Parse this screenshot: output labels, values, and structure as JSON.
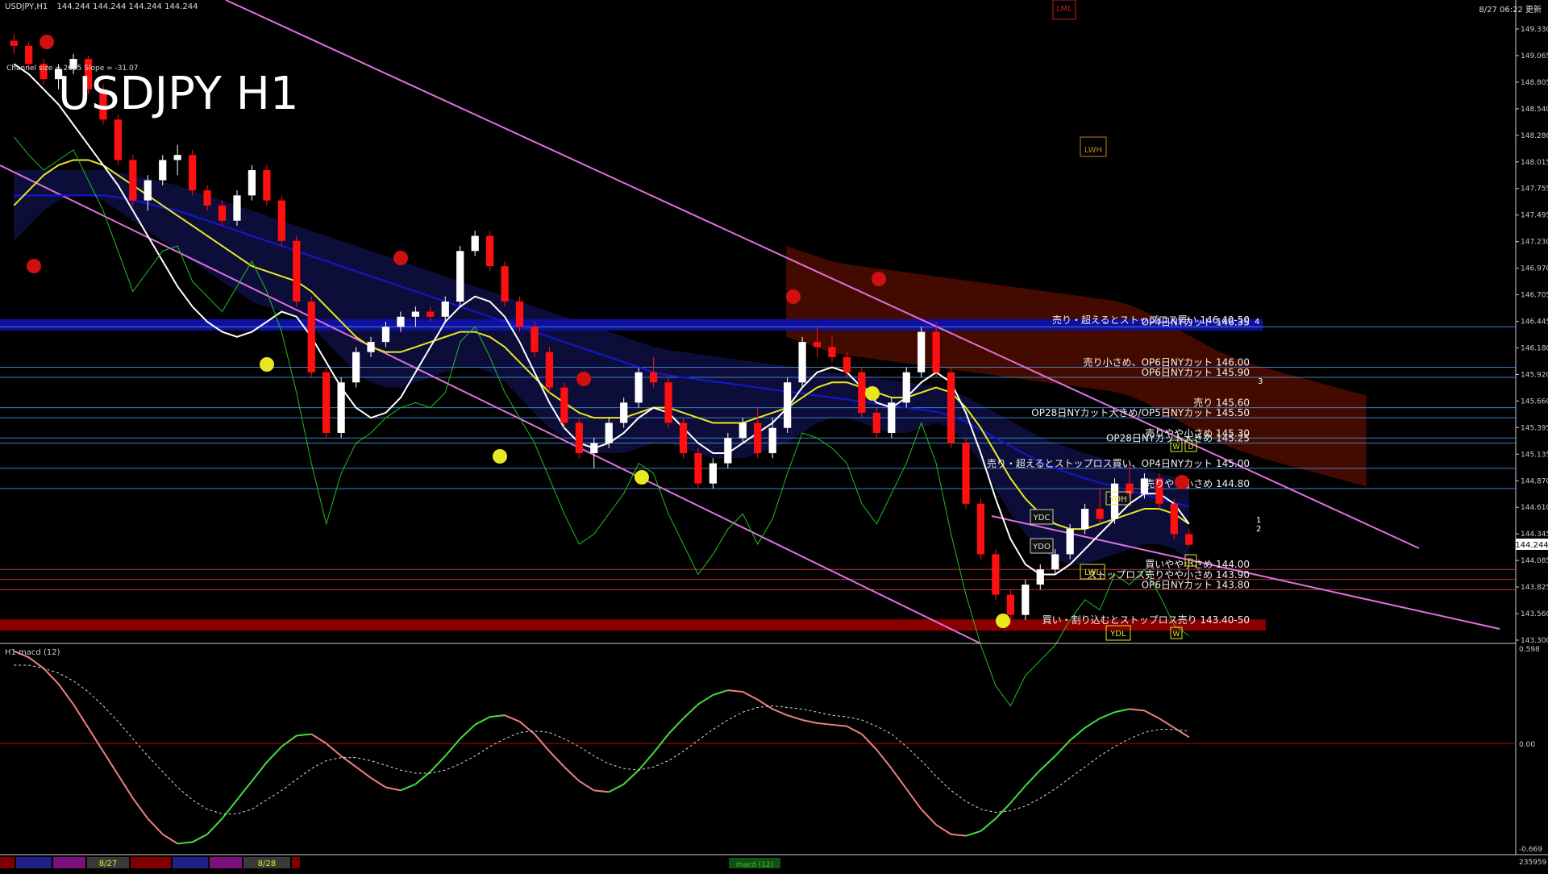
{
  "window": {
    "symbol_header": "USDJPY,H1",
    "ohlc_header": "144.244 144.244 144.244 144.244",
    "datetime": "8/27 06:22 更新",
    "big_title": "USDJPY H1",
    "channel_info": "Channel size = 2695 Slope = -31.07",
    "lml_box": "LML",
    "lwh_box": "LWH",
    "current_price": "144.244"
  },
  "price_axis": {
    "min": 143.3,
    "max": 149.33,
    "ticks": [
      "149.330",
      "149.065",
      "148.805",
      "148.540",
      "148.280",
      "148.015",
      "147.755",
      "147.495",
      "147.230",
      "146.970",
      "146.705",
      "146.445",
      "146.180",
      "145.920",
      "145.660",
      "145.395",
      "145.135",
      "144.870",
      "144.610",
      "144.345",
      "144.085",
      "143.825",
      "143.560",
      "143.300"
    ]
  },
  "levels": [
    {
      "price": 146.42,
      "label": "売り・超えるとストップロス買い 146.40-50",
      "color": "#1010a0",
      "band": true
    },
    {
      "price": 146.4,
      "label": "OP4日NYカット 146.35",
      "color": "#3f7fbf"
    },
    {
      "price": 146.0,
      "label": "売り小さめ、OP6日NYカット 146.00",
      "color": "#3f7fbf"
    },
    {
      "price": 145.9,
      "label": "OP6日NYカット 145.90",
      "color": "#3f7fbf"
    },
    {
      "price": 145.6,
      "label": "売り 145.60",
      "color": "#3f7fbf"
    },
    {
      "price": 145.5,
      "label": "OP28日NYカット大きめ/OP5日NYカット 145.50",
      "color": "#3f7fbf"
    },
    {
      "price": 145.3,
      "label": "売りやや小さめ 145.30",
      "color": "#3f7fbf"
    },
    {
      "price": 145.25,
      "label": "OP28日NYカット大きめ 145.25",
      "color": "#3f7fbf"
    },
    {
      "price": 145.0,
      "label": "売り・超えるとストップロス買い、OP4日NYカット 145.00",
      "color": "#3f7fbf"
    },
    {
      "price": 144.8,
      "label": "売りやや小さめ 144.80",
      "color": "#3f7fbf"
    },
    {
      "price": 144.0,
      "label": "買いやや小さめ 144.00",
      "color": "#c03030"
    },
    {
      "price": 143.9,
      "label": "ストップロス売りやや小さめ 143.90",
      "color": "#c03030"
    },
    {
      "price": 143.8,
      "label": "OP6日NYカット 143.80",
      "color": "#c03030"
    },
    {
      "price": 143.45,
      "label": "買い・割り込むとストップロス売り 143.40-50",
      "color": "#8a0000",
      "band": true
    }
  ],
  "markers": {
    "ydc": "YDC",
    "ydo": "YDO",
    "ydh": "YDH",
    "lwl": "LWL",
    "ydl": "YDL",
    "w1": "W",
    "d1": "D",
    "w2": "W",
    "d2": "D",
    "n1": "1",
    "n2": "2",
    "n3": "3",
    "n4": "4"
  },
  "macd": {
    "label": "H1  macd (12)",
    "max": "0.598",
    "zero": "0.00",
    "min": "-0.669",
    "bottom_right": "235959"
  },
  "date_tabs": [
    "8/27",
    "8/28"
  ],
  "macd_tab": "macd (12)",
  "colors": {
    "bull": "#ffffff",
    "bear": "#ff1010",
    "ma_white": "#ffffff",
    "ma_yellow": "#e8e820",
    "ma_blue": "#1515d8",
    "ichimoku_lag": "#20c020",
    "kumo_blue": "#3030d0",
    "kumo_red": "#c02000",
    "channel": "#e070e0",
    "macd_up": "#40e040",
    "macd_down": "#f08080"
  },
  "chart_data": {
    "type": "candlestick",
    "title": "USDJPY H1",
    "ylim": [
      143.3,
      149.33
    ],
    "candles": [
      [
        149.23,
        149.3,
        149.1,
        149.18
      ],
      [
        149.18,
        149.22,
        148.95,
        149.0
      ],
      [
        149.0,
        149.05,
        148.8,
        148.85
      ],
      [
        148.85,
        149.0,
        148.75,
        148.95
      ],
      [
        148.95,
        149.1,
        148.9,
        149.05
      ],
      [
        149.05,
        149.08,
        148.7,
        148.75
      ],
      [
        148.75,
        148.8,
        148.4,
        148.45
      ],
      [
        148.45,
        148.5,
        148.0,
        148.05
      ],
      [
        148.05,
        148.1,
        147.6,
        147.65
      ],
      [
        147.65,
        147.9,
        147.55,
        147.85
      ],
      [
        147.85,
        148.1,
        147.8,
        148.05
      ],
      [
        148.05,
        148.2,
        147.9,
        148.1
      ],
      [
        148.1,
        148.15,
        147.7,
        147.75
      ],
      [
        147.75,
        147.8,
        147.55,
        147.6
      ],
      [
        147.6,
        147.65,
        147.4,
        147.45
      ],
      [
        147.45,
        147.75,
        147.4,
        147.7
      ],
      [
        147.7,
        148.0,
        147.65,
        147.95
      ],
      [
        147.95,
        148.0,
        147.6,
        147.65
      ],
      [
        147.65,
        147.7,
        147.2,
        147.25
      ],
      [
        147.25,
        147.3,
        146.6,
        146.65
      ],
      [
        146.65,
        146.7,
        145.9,
        145.95
      ],
      [
        145.95,
        146.0,
        145.3,
        145.35
      ],
      [
        145.35,
        145.9,
        145.3,
        145.85
      ],
      [
        145.85,
        146.2,
        145.8,
        146.15
      ],
      [
        146.15,
        146.3,
        146.1,
        146.25
      ],
      [
        146.25,
        146.45,
        146.2,
        146.4
      ],
      [
        146.4,
        146.55,
        146.35,
        146.5
      ],
      [
        146.5,
        146.6,
        146.4,
        146.55
      ],
      [
        146.55,
        146.6,
        146.45,
        146.5
      ],
      [
        146.5,
        146.7,
        146.45,
        146.65
      ],
      [
        146.65,
        147.2,
        146.6,
        147.15
      ],
      [
        147.15,
        147.35,
        147.1,
        147.3
      ],
      [
        147.3,
        147.35,
        146.95,
        147.0
      ],
      [
        147.0,
        147.05,
        146.6,
        146.65
      ],
      [
        146.65,
        146.7,
        146.35,
        146.4
      ],
      [
        146.4,
        146.45,
        146.1,
        146.15
      ],
      [
        146.15,
        146.2,
        145.75,
        145.8
      ],
      [
        145.8,
        145.85,
        145.4,
        145.45
      ],
      [
        145.45,
        145.5,
        145.1,
        145.15
      ],
      [
        145.15,
        145.3,
        145.0,
        145.25
      ],
      [
        145.25,
        145.5,
        145.2,
        145.45
      ],
      [
        145.45,
        145.7,
        145.4,
        145.65
      ],
      [
        145.65,
        146.0,
        145.6,
        145.95
      ],
      [
        145.95,
        146.1,
        145.8,
        145.85
      ],
      [
        145.85,
        145.9,
        145.4,
        145.45
      ],
      [
        145.45,
        145.5,
        145.1,
        145.15
      ],
      [
        145.15,
        145.2,
        144.8,
        144.85
      ],
      [
        144.85,
        145.1,
        144.8,
        145.05
      ],
      [
        145.05,
        145.35,
        145.0,
        145.3
      ],
      [
        145.3,
        145.5,
        145.25,
        145.45
      ],
      [
        145.45,
        145.6,
        145.1,
        145.15
      ],
      [
        145.15,
        145.5,
        145.1,
        145.4
      ],
      [
        145.4,
        145.9,
        145.35,
        145.85
      ],
      [
        145.85,
        146.3,
        145.8,
        146.25
      ],
      [
        146.25,
        146.4,
        146.1,
        146.2
      ],
      [
        146.2,
        146.3,
        146.05,
        146.1
      ],
      [
        146.1,
        146.15,
        145.9,
        145.95
      ],
      [
        145.95,
        146.0,
        145.5,
        145.55
      ],
      [
        145.55,
        145.6,
        145.3,
        145.35
      ],
      [
        145.35,
        145.7,
        145.3,
        145.65
      ],
      [
        145.65,
        146.0,
        145.6,
        145.95
      ],
      [
        145.95,
        146.4,
        145.9,
        146.35
      ],
      [
        146.35,
        146.45,
        145.9,
        145.95
      ],
      [
        145.95,
        146.0,
        145.2,
        145.25
      ],
      [
        145.25,
        145.3,
        144.6,
        144.65
      ],
      [
        144.65,
        144.7,
        144.1,
        144.15
      ],
      [
        144.15,
        144.2,
        143.7,
        143.75
      ],
      [
        143.75,
        143.8,
        143.45,
        143.55
      ],
      [
        143.55,
        143.9,
        143.5,
        143.85
      ],
      [
        143.85,
        144.05,
        143.8,
        144.0
      ],
      [
        144.0,
        144.2,
        143.95,
        144.15
      ],
      [
        144.15,
        144.45,
        144.1,
        144.4
      ],
      [
        144.4,
        144.65,
        144.35,
        144.6
      ],
      [
        144.6,
        144.8,
        144.45,
        144.5
      ],
      [
        144.5,
        144.9,
        144.45,
        144.85
      ],
      [
        144.85,
        145.05,
        144.7,
        144.75
      ],
      [
        144.75,
        144.95,
        144.7,
        144.9
      ],
      [
        144.9,
        144.95,
        144.6,
        144.65
      ],
      [
        144.65,
        144.7,
        144.3,
        144.35
      ],
      [
        144.35,
        144.4,
        144.22,
        144.244
      ]
    ],
    "ma_white": [
      149.0,
      148.9,
      148.75,
      148.6,
      148.4,
      148.2,
      148.0,
      147.8,
      147.55,
      147.3,
      147.05,
      146.8,
      146.6,
      146.45,
      146.35,
      146.3,
      146.35,
      146.45,
      146.55,
      146.5,
      146.3,
      146.05,
      145.8,
      145.6,
      145.5,
      145.55,
      145.7,
      145.95,
      146.2,
      146.45,
      146.6,
      146.7,
      146.65,
      146.5,
      146.25,
      145.95,
      145.65,
      145.4,
      145.25,
      145.2,
      145.25,
      145.35,
      145.5,
      145.6,
      145.55,
      145.4,
      145.25,
      145.15,
      145.15,
      145.25,
      145.35,
      145.45,
      145.6,
      145.8,
      145.95,
      146.0,
      145.95,
      145.8,
      145.65,
      145.6,
      145.7,
      145.85,
      145.95,
      145.85,
      145.55,
      145.15,
      144.7,
      144.3,
      144.05,
      143.95,
      143.95,
      144.05,
      144.2,
      144.35,
      144.5,
      144.65,
      144.75,
      144.75,
      144.65,
      144.45
    ],
    "ma_yellow": [
      147.6,
      147.75,
      147.9,
      148.0,
      148.05,
      148.05,
      148.0,
      147.9,
      147.8,
      147.7,
      147.6,
      147.5,
      147.4,
      147.3,
      147.2,
      147.1,
      147.0,
      146.95,
      146.9,
      146.85,
      146.75,
      146.6,
      146.45,
      146.3,
      146.2,
      146.15,
      146.15,
      146.2,
      146.25,
      146.3,
      146.35,
      146.35,
      146.3,
      146.2,
      146.05,
      145.9,
      145.75,
      145.65,
      145.55,
      145.5,
      145.5,
      145.5,
      145.55,
      145.6,
      145.6,
      145.55,
      145.5,
      145.45,
      145.45,
      145.45,
      145.5,
      145.55,
      145.6,
      145.7,
      145.8,
      145.85,
      145.85,
      145.8,
      145.75,
      145.7,
      145.7,
      145.75,
      145.8,
      145.75,
      145.6,
      145.4,
      145.15,
      144.9,
      144.7,
      144.55,
      144.45,
      144.4,
      144.4,
      144.45,
      144.5,
      144.55,
      144.6,
      144.6,
      144.55,
      144.45
    ],
    "ma_blue": [
      147.7,
      147.7,
      147.7,
      147.7,
      147.7,
      147.7,
      147.7,
      147.68,
      147.65,
      147.62,
      147.58,
      147.55,
      147.5,
      147.45,
      147.4,
      147.35,
      147.3,
      147.25,
      147.2,
      147.15,
      147.1,
      147.05,
      147.0,
      146.95,
      146.9,
      146.85,
      146.8,
      146.75,
      146.7,
      146.65,
      146.6,
      146.55,
      146.5,
      146.45,
      146.4,
      146.35,
      146.3,
      146.25,
      146.2,
      146.15,
      146.1,
      146.05,
      146.0,
      145.95,
      145.92,
      145.9,
      145.88,
      145.86,
      145.84,
      145.82,
      145.8,
      145.78,
      145.76,
      145.74,
      145.72,
      145.7,
      145.68,
      145.66,
      145.64,
      145.62,
      145.6,
      145.58,
      145.56,
      145.52,
      145.46,
      145.38,
      145.3,
      145.22,
      145.14,
      145.06,
      145.0,
      144.95,
      144.9,
      144.86,
      144.82,
      144.78,
      144.74,
      144.7,
      144.66,
      144.62
    ],
    "macd_line": [
      0.59,
      0.55,
      0.48,
      0.38,
      0.25,
      0.1,
      -0.05,
      -0.2,
      -0.35,
      -0.48,
      -0.58,
      -0.64,
      -0.63,
      -0.58,
      -0.48,
      -0.36,
      -0.24,
      -0.12,
      -0.02,
      0.05,
      0.06,
      0.0,
      -0.08,
      -0.15,
      -0.22,
      -0.28,
      -0.3,
      -0.26,
      -0.18,
      -0.08,
      0.03,
      0.12,
      0.17,
      0.18,
      0.14,
      0.06,
      -0.05,
      -0.15,
      -0.24,
      -0.3,
      -0.31,
      -0.26,
      -0.17,
      -0.06,
      0.06,
      0.16,
      0.25,
      0.31,
      0.34,
      0.33,
      0.28,
      0.22,
      0.18,
      0.15,
      0.13,
      0.12,
      0.11,
      0.06,
      -0.04,
      -0.16,
      -0.29,
      -0.42,
      -0.52,
      -0.58,
      -0.59,
      -0.56,
      -0.48,
      -0.38,
      -0.27,
      -0.17,
      -0.08,
      0.02,
      0.1,
      0.16,
      0.2,
      0.22,
      0.21,
      0.16,
      0.1,
      0.04
    ],
    "macd_signal": [
      0.5,
      0.5,
      0.48,
      0.45,
      0.4,
      0.33,
      0.24,
      0.14,
      0.03,
      -0.08,
      -0.18,
      -0.28,
      -0.36,
      -0.42,
      -0.45,
      -0.45,
      -0.42,
      -0.36,
      -0.3,
      -0.23,
      -0.16,
      -0.11,
      -0.09,
      -0.09,
      -0.11,
      -0.14,
      -0.17,
      -0.19,
      -0.19,
      -0.17,
      -0.13,
      -0.08,
      -0.02,
      0.03,
      0.07,
      0.08,
      0.07,
      0.03,
      -0.02,
      -0.08,
      -0.13,
      -0.16,
      -0.17,
      -0.15,
      -0.11,
      -0.05,
      0.02,
      0.09,
      0.15,
      0.2,
      0.23,
      0.24,
      0.23,
      0.22,
      0.2,
      0.18,
      0.17,
      0.15,
      0.11,
      0.06,
      -0.02,
      -0.11,
      -0.21,
      -0.3,
      -0.37,
      -0.42,
      -0.44,
      -0.43,
      -0.4,
      -0.35,
      -0.29,
      -0.22,
      -0.15,
      -0.08,
      -0.02,
      0.03,
      0.07,
      0.09,
      0.09,
      0.08
    ]
  }
}
